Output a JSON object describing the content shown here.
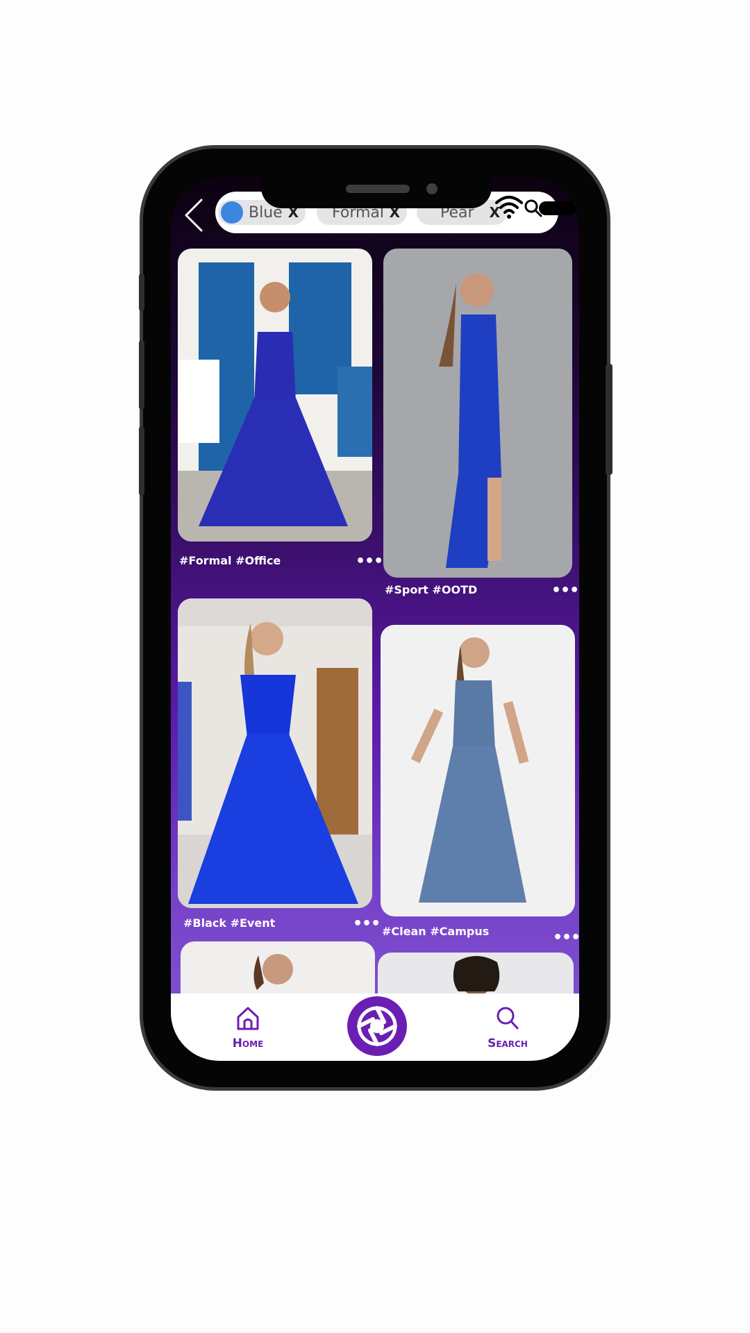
{
  "filters": [
    {
      "label": "Blue",
      "remove": "X",
      "color": "#3a86e0"
    },
    {
      "label": "Formal",
      "remove": "X"
    },
    {
      "label": "Pear",
      "remove": "X"
    }
  ],
  "posts": [
    {
      "tags": "#Formal #Office",
      "more": "•••"
    },
    {
      "tags": "#Sport #OOTD",
      "more": "•••"
    },
    {
      "tags": "#Black #Event",
      "more": "•••"
    },
    {
      "tags": "#Clean #Campus",
      "more": "•••"
    }
  ],
  "nav": {
    "home_label": "Home",
    "search_label": "Search",
    "accent": "#6a1fb2"
  }
}
